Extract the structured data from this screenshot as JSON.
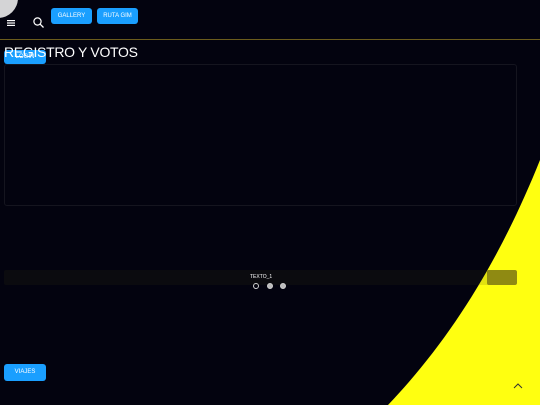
{
  "theme": {
    "background": "#03030f",
    "accent_yellow": "#ffff10",
    "button_blue": "#1a9fff",
    "text_white": "#ffffff"
  },
  "header": {
    "menu_icon": "hamburger-menu-icon",
    "search_icon": "search-icon",
    "nav_buttons": [
      {
        "label": "GALLERY"
      },
      {
        "label": "RUTA GIM"
      }
    ]
  },
  "main": {
    "title": "REGISTRO Y VOTOS",
    "login_button": "LOGIN",
    "carousel": {
      "label": "TEXTO_1",
      "slide_count": 3,
      "active_index": 0,
      "progress_fraction": 0.06
    },
    "viajes_button": "VIAJES"
  },
  "footer": {
    "scroll_top_icon": "chevron-up-icon"
  }
}
